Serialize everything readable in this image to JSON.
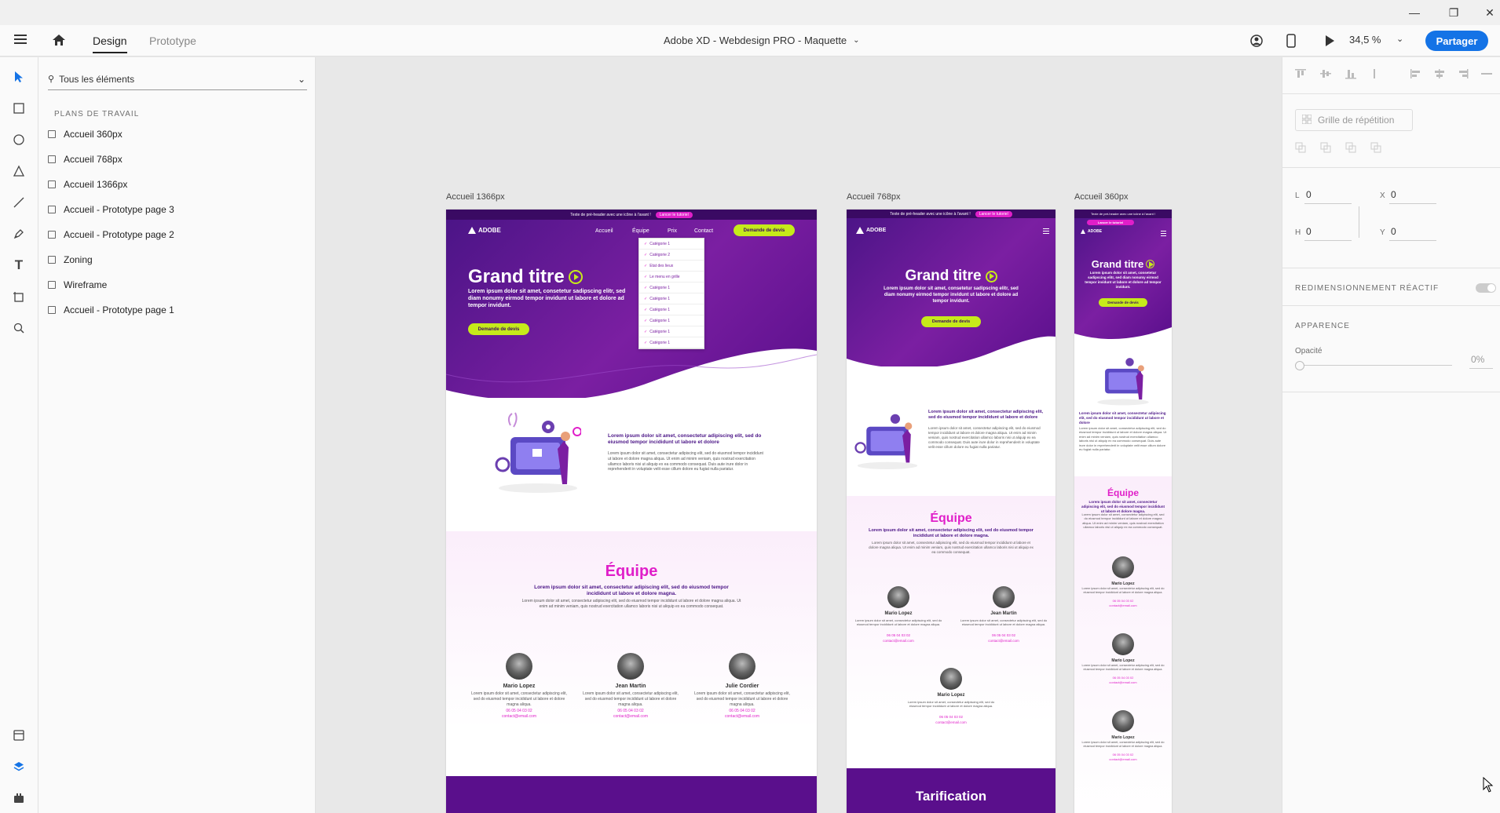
{
  "toolbar": {
    "tab_design": "Design",
    "tab_prototype": "Prototype",
    "doc_title": "Adobe XD - Webdesign PRO - Maquette",
    "zoom": "34,5 %",
    "share_label": "Partager"
  },
  "layers": {
    "search_label": "Tous les éléments",
    "section_title": "PLANS DE TRAVAIL",
    "items": [
      "Accueil 360px",
      "Accueil 768px",
      "Accueil 1366px",
      "Accueil - Prototype page 3",
      "Accueil - Prototype page 2",
      "Zoning",
      "Wireframe",
      "Accueil - Prototype page 1"
    ]
  },
  "properties": {
    "repeat_grid": "Grille de répétition",
    "w_label": "L",
    "w_value": "0",
    "x_label": "X",
    "x_value": "0",
    "h_label": "H",
    "h_value": "0",
    "y_label": "Y",
    "y_value": "0",
    "responsive_resize": "REDIMENSIONNEMENT RÉACTIF",
    "appearance": "APPARENCE",
    "opacity_label": "Opacité",
    "opacity_value": "0%"
  },
  "artboards": {
    "desktop_label": "Accueil 1366px",
    "tablet_label": "Accueil 768px",
    "mobile_label": "Accueil 360px",
    "topbar_text": "Texte de pré-header avec une icône à l'avant !",
    "topbar_pill": "Lancer le tutoriel",
    "logo": "ADOBE",
    "nav": [
      "Accueil",
      "Équipe",
      "Prix",
      "Contact"
    ],
    "cta": "Demande de devis",
    "hero_title": "Grand titre",
    "hero_sub": "Lorem ipsum dolor sit amet, consetetur sadipscing elitr, sed diam nonumy eirmod tempor invidunt ut labore et dolore ad tempor invidunt.",
    "intro_strong": "Lorem ipsum dolor sit amet, consectetur adipiscing elit, sed do eiusmod tempor incididunt ut labore et dolore",
    "intro_text": "Lorem ipsum dolor sit amet, consectetur adipiscing elit, sed do eiusmod tempor incididunt ut labore et dolore magna aliqua. Ut enim ad minim veniam, quis nostrud exercitation ullamco laboris nisi ut aliquip ex ea commodo consequat. Duis aute irure dolor in reprehenderit in voluptate velit esse cillum dolore eu fugiat nulla pariatur.",
    "team_title": "Équipe",
    "team_strong": "Lorem ipsum dolor sit amet, consectetur adipiscing elit, sed do eiusmod tempor incididunt ut labore et dolore magna.",
    "team_text": "Lorem ipsum dolor sit amet, consectetur adipiscing elit, sed do eiusmod tempor incididunt ut labore et dolore magna aliqua. Ut enim ad minim veniam, quis nostrud exercitation ullamco laboris nisi ut aliquip ex ea commodo consequat.",
    "members": [
      "Mario Lopez",
      "Jean Martin",
      "Julie Cordier"
    ],
    "member_text": "Lorem ipsum dolor sit amet, consectetur adipiscing elit, sed do eiusmod tempor incididunt ut labore et dolore magna aliqua.",
    "phone": "06 05 04 03 02",
    "email": "contact@email.com",
    "pricing_title": "Tarification",
    "dropdown": [
      "Catégorie 1",
      "Catégorie 2",
      "Etat des lieux",
      "Le menu en grille",
      "Catégorie 1",
      "Catégorie 1",
      "Catégorie 1",
      "Catégorie 1",
      "Catégorie 1",
      "Catégorie 1"
    ]
  }
}
